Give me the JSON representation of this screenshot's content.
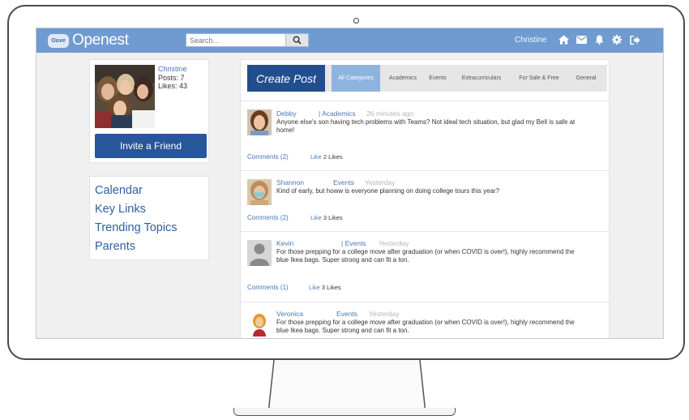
{
  "app": {
    "logo_badge": "Ouve",
    "name": "Openest"
  },
  "search": {
    "placeholder": "Search..."
  },
  "topbar": {
    "user": "Christine",
    "icons": [
      "home-icon",
      "mail-icon",
      "bell-icon",
      "gear-icon",
      "sign-out-icon"
    ]
  },
  "profile": {
    "name": "Christine",
    "posts": "Posts: 7",
    "likes": "Likes: 43",
    "invite_label": "Invite a Friend"
  },
  "nav_links": [
    "Calendar",
    "Key Links",
    "Trending Topics",
    "Parents"
  ],
  "feed": {
    "create_label": "Create Post",
    "categories": [
      "All Categories",
      "Academics",
      "Events",
      "Extracurriculars",
      "For Sale & Free",
      "General"
    ],
    "active_category": "All Categories",
    "posts": [
      {
        "author": "Debby",
        "category": "| Academics",
        "time": "26 minutes ago",
        "text": "Anyone else's son having tech problems with Teams? Not ideal tech situation, but glad my Bell is safe at home!",
        "comments": "Comments (2)",
        "like_label": "Like",
        "likes": "2 Likes"
      },
      {
        "author": "Shannon",
        "category": "Events",
        "time": "Yesterday",
        "text": "Kind of early, but howw is everyone planning on doing college tours this year?",
        "comments": "Comments (2)",
        "like_label": "Like",
        "likes": "3 Likes"
      },
      {
        "author": "Kevin",
        "category": "| Events",
        "time": "Yesterday",
        "text": "For those prepping for a college move after graduation (or when COVID is over!), highly recommend the blue Ikea bags. Super strong and can fit a ton.",
        "comments": "Comments (1)",
        "like_label": "Like",
        "likes": "3 Likes"
      },
      {
        "author": "Veronica",
        "category": "Events",
        "time": "Yesterday",
        "text": "For those prepping for a college move after graduation (or when COVID is over!), highly recommend the blue Ikea bags. Super strong and can fit a ton.",
        "comments": "",
        "like_label": "",
        "likes": ""
      }
    ]
  },
  "colors": {
    "topbar": "#6f9bd0",
    "primary_button": "#27569a",
    "link": "#2f5f9f",
    "active_tab": "#8fb3df"
  }
}
